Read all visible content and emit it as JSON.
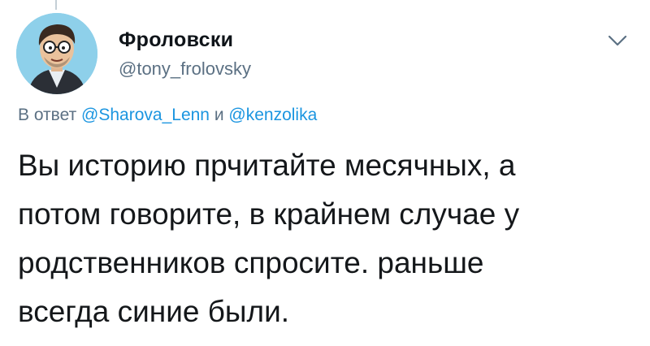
{
  "author": {
    "display_name": "Фроловски",
    "handle": "@tony_frolovsky"
  },
  "reply": {
    "prefix": "В ответ",
    "mention_1": "@Sharova_Lenn",
    "connector": "и",
    "mention_2": "@kenzolika"
  },
  "tweet": {
    "lines": [
      "Вы историю прчитайте месячных, а",
      "потом говорите, в крайнем случае у",
      "родственников спросите. раньше",
      "всегда синие были."
    ]
  },
  "icons": {
    "menu": "chevron-down-icon",
    "avatar": "cartoon-avatar"
  },
  "colors": {
    "link": "#1b95e0",
    "secondary_text": "#5b7083",
    "primary_text": "#14171a",
    "avatar_bg": "#8ed0ea"
  }
}
